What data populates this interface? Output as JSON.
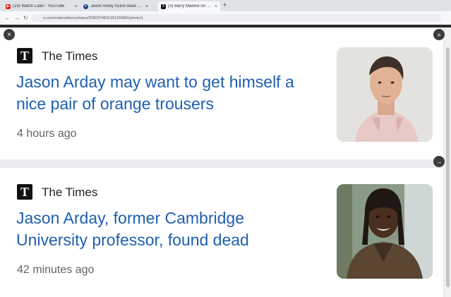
{
  "browser": {
    "tabs": [
      {
        "label": "(19) Watch Later - YouTube",
        "icon": "youtube-icon",
        "color": "#e62117"
      },
      {
        "label": "Jason Arday found dead after ...",
        "icon": "news-icon",
        "color": "#1b3a8a"
      },
      {
        "label": "(3) Barry Malone on X: \"Two w...",
        "icon": "x-logo-icon",
        "color": "#111111"
      }
    ],
    "url": "x.com/malonebarry/status/2080374831351155865/photo/1"
  },
  "cards": [
    {
      "publisher": "The Times",
      "logo_letter": "T",
      "headline_lines": [
        "Jason Arday may want to get himself a",
        "nice pair of orange trousers"
      ],
      "time": "4 hours ago",
      "thumbnail": "portrait-man-pink-shirt"
    },
    {
      "publisher": "The Times",
      "logo_letter": "T",
      "headline_lines": [
        "Jason Arday, former Cambridge",
        "University professor, found dead"
      ],
      "time": "42 minutes ago",
      "thumbnail": "portrait-man-locs-jacket"
    }
  ],
  "viewer": {
    "close_icon": "×",
    "expand_icon": "»",
    "next_icon": "→"
  },
  "colors": {
    "headline": "#1f5fb0",
    "publisher": "#202124",
    "time": "#5f6368",
    "background": "#e9ebee"
  }
}
